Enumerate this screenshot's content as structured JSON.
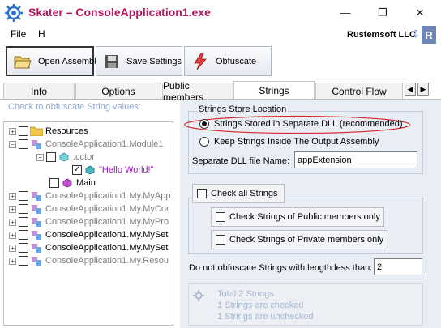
{
  "window": {
    "title": "Skater – ConsoleApplication1.exe",
    "minimize": "—",
    "restore": "❐",
    "close": "✕"
  },
  "menu": {
    "file": "File",
    "help": "H"
  },
  "branding": {
    "company": "Rustemsoft LLC",
    "download_glyph": "⇩",
    "logo_letter": "R"
  },
  "toolbar": {
    "open_label": "Open Assembly",
    "settings_label": "Save Settings",
    "obfuscate_label": "Obfuscate"
  },
  "tabs": [
    "Info",
    "Options",
    "Public members",
    "Strings",
    "Control Flow"
  ],
  "tab_arrows": {
    "left": "◀",
    "right": "▶"
  },
  "left": {
    "hint": "Check to obfuscate String values:",
    "tree": [
      {
        "label": "Resources",
        "style": "normal",
        "icon": "folder-icon"
      },
      {
        "label": "ConsoleApplication1.Module1",
        "style": "grey",
        "icon": "module-icon"
      },
      {
        "label": ".cctor",
        "style": "grey",
        "icon": "method-icon"
      },
      {
        "label": "\"Hello World!\"",
        "style": "purple",
        "icon": "string-icon",
        "checked": true
      },
      {
        "label": "Main",
        "style": "normal",
        "icon": "method-icon"
      },
      {
        "label": "ConsoleApplication1.My.MyApp",
        "style": "grey",
        "icon": "class-icon"
      },
      {
        "label": "ConsoleApplication1.My.MyCor",
        "style": "grey",
        "icon": "class-icon"
      },
      {
        "label": "ConsoleApplication1.My.MyPro",
        "style": "grey",
        "icon": "class-icon"
      },
      {
        "label": "ConsoleApplication1.My.MySet",
        "style": "normal",
        "icon": "class-icon"
      },
      {
        "label": "ConsoleApplication1.My.MySet",
        "style": "normal",
        "icon": "class-icon"
      },
      {
        "label": "ConsoleApplication1.My.Resou",
        "style": "grey",
        "icon": "class-icon"
      }
    ]
  },
  "strings": {
    "store_title": "Strings Store Location",
    "option_separate": "Strings Stored in Separate DLL (recommended)",
    "option_inside": "Keep Strings Inside The Output Assembly",
    "dll_label": "Separate DLL file Name:",
    "dll_value": "appExtension",
    "check_all": "Check all Strings",
    "check_public": "Check Strings of Public members only",
    "check_private": "Check Strings of Private members only",
    "min_length_label": "Do not obfuscate Strings with length less than:",
    "min_length_value": "2",
    "stats": [
      "Total 2 Strings",
      "1 Strings are checked",
      "1 Strings are unchecked"
    ]
  }
}
